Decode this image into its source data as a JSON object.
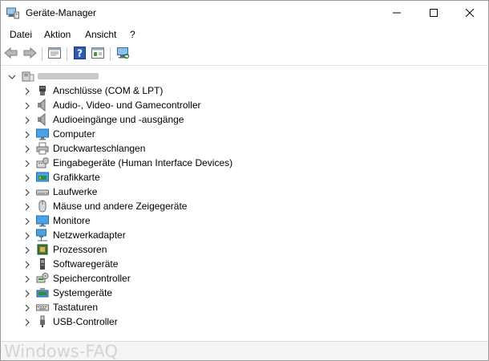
{
  "window": {
    "title": "Geräte-Manager",
    "controls": {
      "minimize": "minimize-icon",
      "maximize": "maximize-icon",
      "close": "close-icon"
    }
  },
  "menu": [
    {
      "label": "Datei"
    },
    {
      "label": "Aktion"
    },
    {
      "label": "Ansicht"
    },
    {
      "label": "?"
    }
  ],
  "toolbar": {
    "buttons": [
      "back-arrow-icon",
      "forward-arrow-icon",
      "properties-icon",
      "help-icon",
      "update-driver-icon",
      "scan-hardware-icon"
    ]
  },
  "tree": {
    "root": {
      "expanded": true,
      "icon": "computer-tree-icon"
    },
    "categories": [
      {
        "label": "Anschlüsse (COM & LPT)",
        "icon": "port-icon"
      },
      {
        "label": "Audio-, Video- und Gamecontroller",
        "icon": "speaker-icon"
      },
      {
        "label": "Audioeingänge und -ausgänge",
        "icon": "speaker-icon"
      },
      {
        "label": "Computer",
        "icon": "monitor-icon"
      },
      {
        "label": "Druckwarteschlangen",
        "icon": "printer-icon"
      },
      {
        "label": "Eingabegeräte (Human Interface Devices)",
        "icon": "hid-icon"
      },
      {
        "label": "Grafikkarte",
        "icon": "display-adapter-icon"
      },
      {
        "label": "Laufwerke",
        "icon": "disk-drive-icon"
      },
      {
        "label": "Mäuse und andere Zeigegeräte",
        "icon": "mouse-icon"
      },
      {
        "label": "Monitore",
        "icon": "monitor-icon"
      },
      {
        "label": "Netzwerkadapter",
        "icon": "network-adapter-icon"
      },
      {
        "label": "Prozessoren",
        "icon": "processor-icon"
      },
      {
        "label": "Softwaregeräte",
        "icon": "software-device-icon"
      },
      {
        "label": "Speichercontroller",
        "icon": "storage-controller-icon"
      },
      {
        "label": "Systemgeräte",
        "icon": "system-device-icon"
      },
      {
        "label": "Tastaturen",
        "icon": "keyboard-icon"
      },
      {
        "label": "USB-Controller",
        "icon": "usb-icon"
      }
    ]
  },
  "watermark": "Windows-FAQ",
  "colors": {
    "accent": "#1e6fc9",
    "chevron": "#444444"
  }
}
